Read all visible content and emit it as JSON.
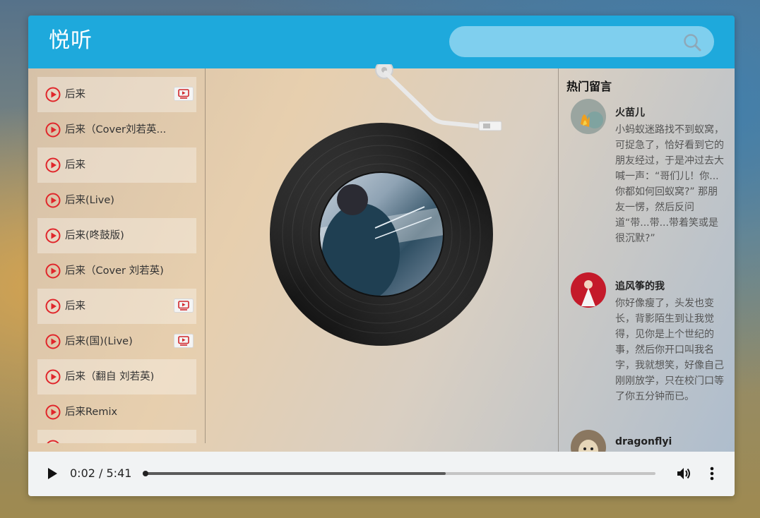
{
  "header": {
    "logo": "悦听",
    "search": {
      "placeholder": "",
      "value": ""
    }
  },
  "playlist": [
    {
      "title": "后来",
      "has_mv": true
    },
    {
      "title": "后来（Cover刘若英...",
      "has_mv": false
    },
    {
      "title": "后来",
      "has_mv": false
    },
    {
      "title": "后来(Live)",
      "has_mv": false
    },
    {
      "title": "后来(咚鼓版)",
      "has_mv": false
    },
    {
      "title": "后来（Cover 刘若英)",
      "has_mv": false
    },
    {
      "title": "后来",
      "has_mv": true
    },
    {
      "title": "后来(国)(Live)",
      "has_mv": true
    },
    {
      "title": "后来（翻自 刘若英)",
      "has_mv": false
    },
    {
      "title": "后来Remix",
      "has_mv": false
    },
    {
      "title": "",
      "has_mv": false
    }
  ],
  "comments": {
    "title": "热门留言",
    "items": [
      {
        "user": "火苗儿",
        "text": "小蚂蚁迷路找不到蚁窝，可捉急了，恰好看到它的朋友经过，于是冲过去大喊一声：“哥们儿！你...你都如何回蚁窝?” 那朋友一愣，然后反问道“带...带...带着笑或是很沉默?”"
      },
      {
        "user": "追风筝的我",
        "text": "你好像瘦了，头发也变长，背影陌生到让我觉得，见你是上个世纪的事，然后你开口叫我名字，我就想笑，好像自己刚刚放学，只在校门口等了你五分钟而已。"
      },
      {
        "user": "dragonflyi",
        "text": ""
      }
    ]
  },
  "player": {
    "time_label": "0:02 / 5:41",
    "progress": 0.59
  },
  "icons": {
    "play_list": "play-circle-icon",
    "mv": "mv-icon",
    "search": "search-icon",
    "player_play": "play-icon",
    "volume": "volume-icon",
    "more": "more-vert-icon"
  },
  "colors": {
    "header": "#1ea9dc",
    "accent_red": "#e0262b",
    "player_bg": "#f1f3f4"
  }
}
